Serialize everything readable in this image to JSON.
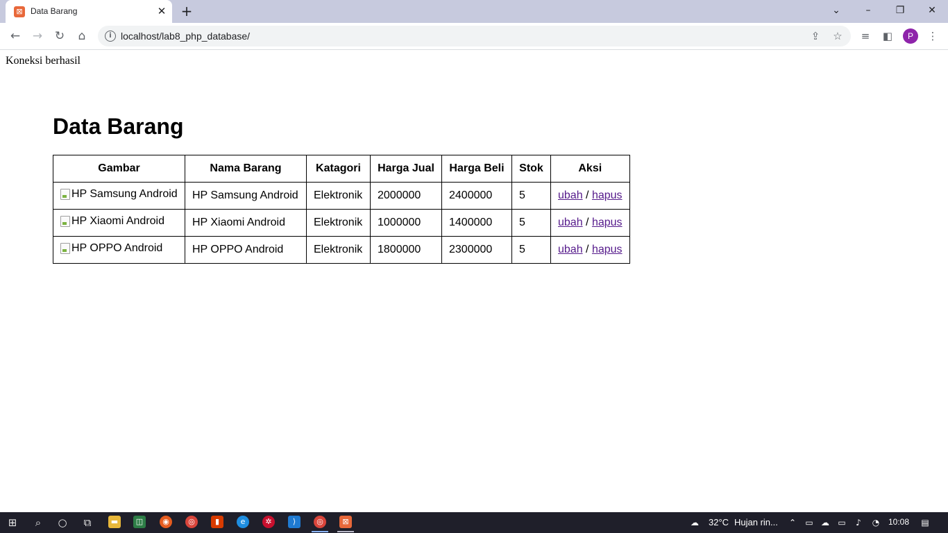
{
  "browser": {
    "tab_title": "Data Barang",
    "url": "localhost/lab8_php_database/",
    "profile_initial": "P"
  },
  "page": {
    "status": "Koneksi berhasil",
    "title": "Data Barang"
  },
  "table": {
    "headers": [
      "Gambar",
      "Nama Barang",
      "Katagori",
      "Harga Jual",
      "Harga Beli",
      "Stok",
      "Aksi"
    ],
    "rows": [
      {
        "gambar_alt": "HP Samsung Android",
        "nama": "HP Samsung Android",
        "kategori": "Elektronik",
        "harga_jual": "2000000",
        "harga_beli": "2400000",
        "stok": "5"
      },
      {
        "gambar_alt": "HP Xiaomi Android",
        "nama": "HP Xiaomi Android",
        "kategori": "Elektronik",
        "harga_jual": "1000000",
        "harga_beli": "1400000",
        "stok": "5"
      },
      {
        "gambar_alt": "HP OPPO Android",
        "nama": "HP OPPO Android",
        "kategori": "Elektronik",
        "harga_jual": "1800000",
        "harga_beli": "2300000",
        "stok": "5"
      }
    ],
    "action_edit": "ubah",
    "action_separator": "/",
    "action_delete": "hapus"
  },
  "taskbar": {
    "temperature": "32°C",
    "weather": "Hujan rin...",
    "time": "10:08"
  },
  "colors": {
    "tabstrip": "#c7cade",
    "link_visited": "#551a8b",
    "profile": "#8e24aa",
    "taskbar": "#1f1f2a"
  }
}
